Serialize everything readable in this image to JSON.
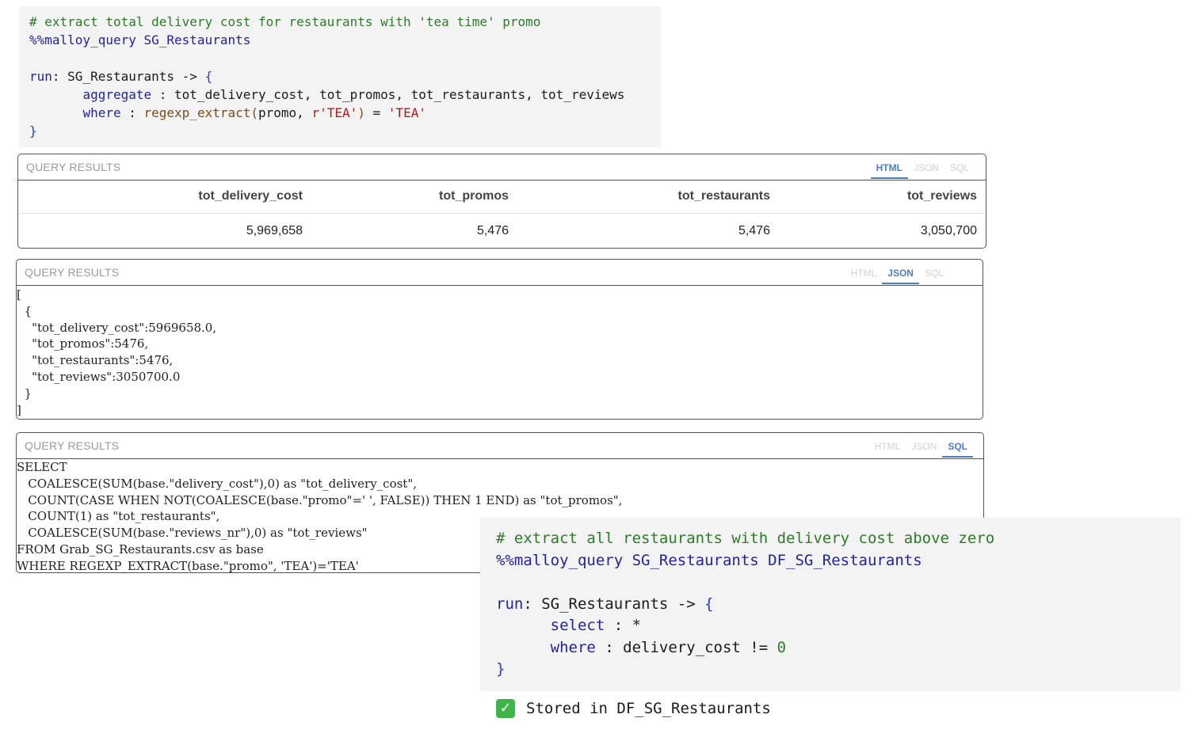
{
  "cell1": {
    "comment": "# extract total delivery cost for restaurants with 'tea time' promo",
    "magic": "%%malloy_query SG_Restaurants",
    "run_kw": "run",
    "run_rest": ": SG_Restaurants -> ",
    "open_brace": "{",
    "aggregate_kw": "aggregate",
    "aggregate_rest": " : tot_delivery_cost, tot_promos, tot_restaurants, tot_reviews",
    "where_kw": "where",
    "where_sep": " : ",
    "where_fn": "regexp_extract(",
    "where_arg": "promo, ",
    "where_pattern": "r'TEA'",
    "where_close": ")",
    "where_eq": " = ",
    "where_value": "'TEA'",
    "close_brace": "}"
  },
  "panel_title": "QUERY RESULTS",
  "tabs": [
    "HTML",
    "JSON",
    "SQL"
  ],
  "html_result": {
    "columns": [
      "tot_delivery_cost",
      "tot_promos",
      "tot_restaurants",
      "tot_reviews"
    ],
    "rows": [
      [
        "5,969,658",
        "5,476",
        "5,476",
        "3,050,700"
      ]
    ]
  },
  "json_result": "[\n  {\n    \"tot_delivery_cost\":5969658.0,\n    \"tot_promos\":5476,\n    \"tot_restaurants\":5476,\n    \"tot_reviews\":3050700.0\n  }\n]",
  "sql_result": "SELECT\n   COALESCE(SUM(base.\"delivery_cost\"),0) as \"tot_delivery_cost\",\n   COUNT(CASE WHEN NOT(COALESCE(base.\"promo\"=' ', FALSE)) THEN 1 END) as \"tot_promos\",\n   COUNT(1) as \"tot_restaurants\",\n   COALESCE(SUM(base.\"reviews_nr\"),0) as \"tot_reviews\"\nFROM Grab_SG_Restaurants.csv as base\nWHERE REGEXP_EXTRACT(base.\"promo\", 'TEA')='TEA'",
  "cell2": {
    "comment": "# extract all restaurants with delivery cost above zero",
    "magic": "%%malloy_query SG_Restaurants DF_SG_Restaurants",
    "run_kw": "run",
    "run_rest": ": SG_Restaurants -> ",
    "open_brace": "{",
    "select_kw": "select",
    "select_rest": " : *",
    "where_kw": "where",
    "where_rest": " : delivery_cost != ",
    "where_num": "0",
    "close_brace": "}"
  },
  "stored_message": "Stored in DF_SG_Restaurants",
  "colors": {
    "comment": "#2f7a2a",
    "keyword": "#2424a0",
    "string": "#b1191c",
    "tab_active": "#4a7dc4",
    "check": "#3fb549"
  }
}
